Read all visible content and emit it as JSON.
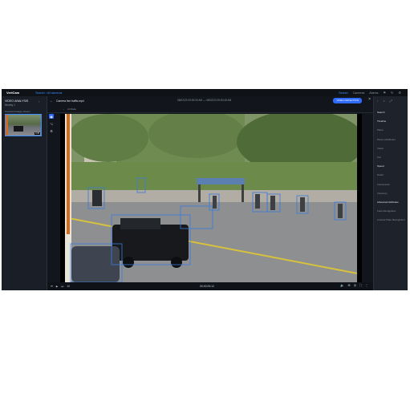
{
  "topbar": {
    "logo": "VertCam",
    "crumb": "Search › All cameras",
    "nav": [
      "Search",
      "Cameras",
      "Alarms"
    ],
    "active_nav": "Search",
    "icons": [
      "flag-icon",
      "refresh-icon",
      "settings-icon"
    ]
  },
  "left": {
    "site_name": "VIDEO ANALYSIS",
    "site_sub": "Nearby 1",
    "collapse_icon": "chevron-left-icon",
    "camera_label": "Camera footage stream",
    "thumbnail_duration": "0:45"
  },
  "main": {
    "file_name": "Camera live traffic.mp4",
    "date_range": "08/02/23 09:00:00 AM  —  08/02/23 09:00:45 AM",
    "primary_button": "VIDEO DETECTION",
    "mode": "Al Mode",
    "tools": [
      "filter-icon",
      "connect-icon",
      "settings-icon"
    ],
    "timecode": "00:00:25:12",
    "speed": "1X"
  },
  "right": {
    "header_icons": [
      "chevron-left-icon",
      "close-icon",
      "expand-icon"
    ],
    "items": [
      {
        "label": "Search",
        "strong": true
      },
      {
        "label": "Timeline",
        "strong": true
      },
      {
        "label": "Place",
        "strong": false
      },
      {
        "label": "Person Attributes",
        "strong": false
      },
      {
        "label": "Vision",
        "strong": false
      },
      {
        "label": "Car",
        "strong": false
      },
      {
        "label": "Speed",
        "strong": true
      },
      {
        "label": "Detail",
        "strong": false
      },
      {
        "label": "Instruments",
        "strong": false
      },
      {
        "label": "Inventory",
        "strong": false
      },
      {
        "label": "Advanced Attributes",
        "strong": true
      },
      {
        "label": "Face Recognition",
        "strong": false
      },
      {
        "label": "License Plate Recognition",
        "strong": false
      }
    ]
  },
  "colors": {
    "accent": "#2f6bff",
    "panel": "#1d222b",
    "detection_box": "#3b7bdc"
  }
}
